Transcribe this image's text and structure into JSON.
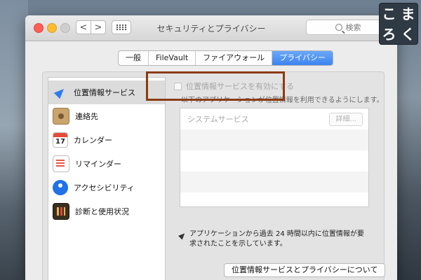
{
  "window": {
    "title": "セキュリティとプライバシー",
    "search_placeholder": "検索",
    "nav_back": "<",
    "nav_forward": ">"
  },
  "tabs": [
    {
      "label": "一般",
      "active": false
    },
    {
      "label": "FileVault",
      "active": false
    },
    {
      "label": "ファイアウォール",
      "active": false
    },
    {
      "label": "プライバシー",
      "active": true
    }
  ],
  "sidebar": {
    "items": [
      {
        "label": "位置情報サービス",
        "icon": "location-arrow-icon",
        "selected": true
      },
      {
        "label": "連絡先",
        "icon": "contacts-book-icon",
        "selected": false
      },
      {
        "label": "カレンダー",
        "icon": "calendar-icon",
        "calendar_day": "17",
        "selected": false
      },
      {
        "label": "リマインダー",
        "icon": "reminders-list-icon",
        "selected": false
      },
      {
        "label": "アクセシビリティ",
        "icon": "accessibility-icon",
        "selected": false
      },
      {
        "label": "診断と使用状況",
        "icon": "diagnostics-icon",
        "selected": false
      }
    ]
  },
  "main": {
    "enable_label": "位置情報サービスを有効にする",
    "enable_checked": false,
    "sub_text": "以下のアプリケーションが位置情報を利用できるようにします。",
    "table_rows": [
      {
        "label": "システムサービス",
        "details": "詳細..."
      },
      {
        "label": ""
      },
      {
        "label": ""
      },
      {
        "label": ""
      },
      {
        "label": ""
      }
    ],
    "info_text": "アプリケーションから過去 24 時間以内に位置情報が要求されたことを示しています。",
    "about_button": "位置情報サービスとプライバシーについて"
  },
  "logo": {
    "chars": [
      "こ",
      "ま",
      "ろ",
      "く"
    ]
  },
  "colors": {
    "accent": "#3c84ef",
    "highlight_border": "#8a3b12",
    "close": "#fc5f57",
    "minimize": "#fdbc2e"
  }
}
